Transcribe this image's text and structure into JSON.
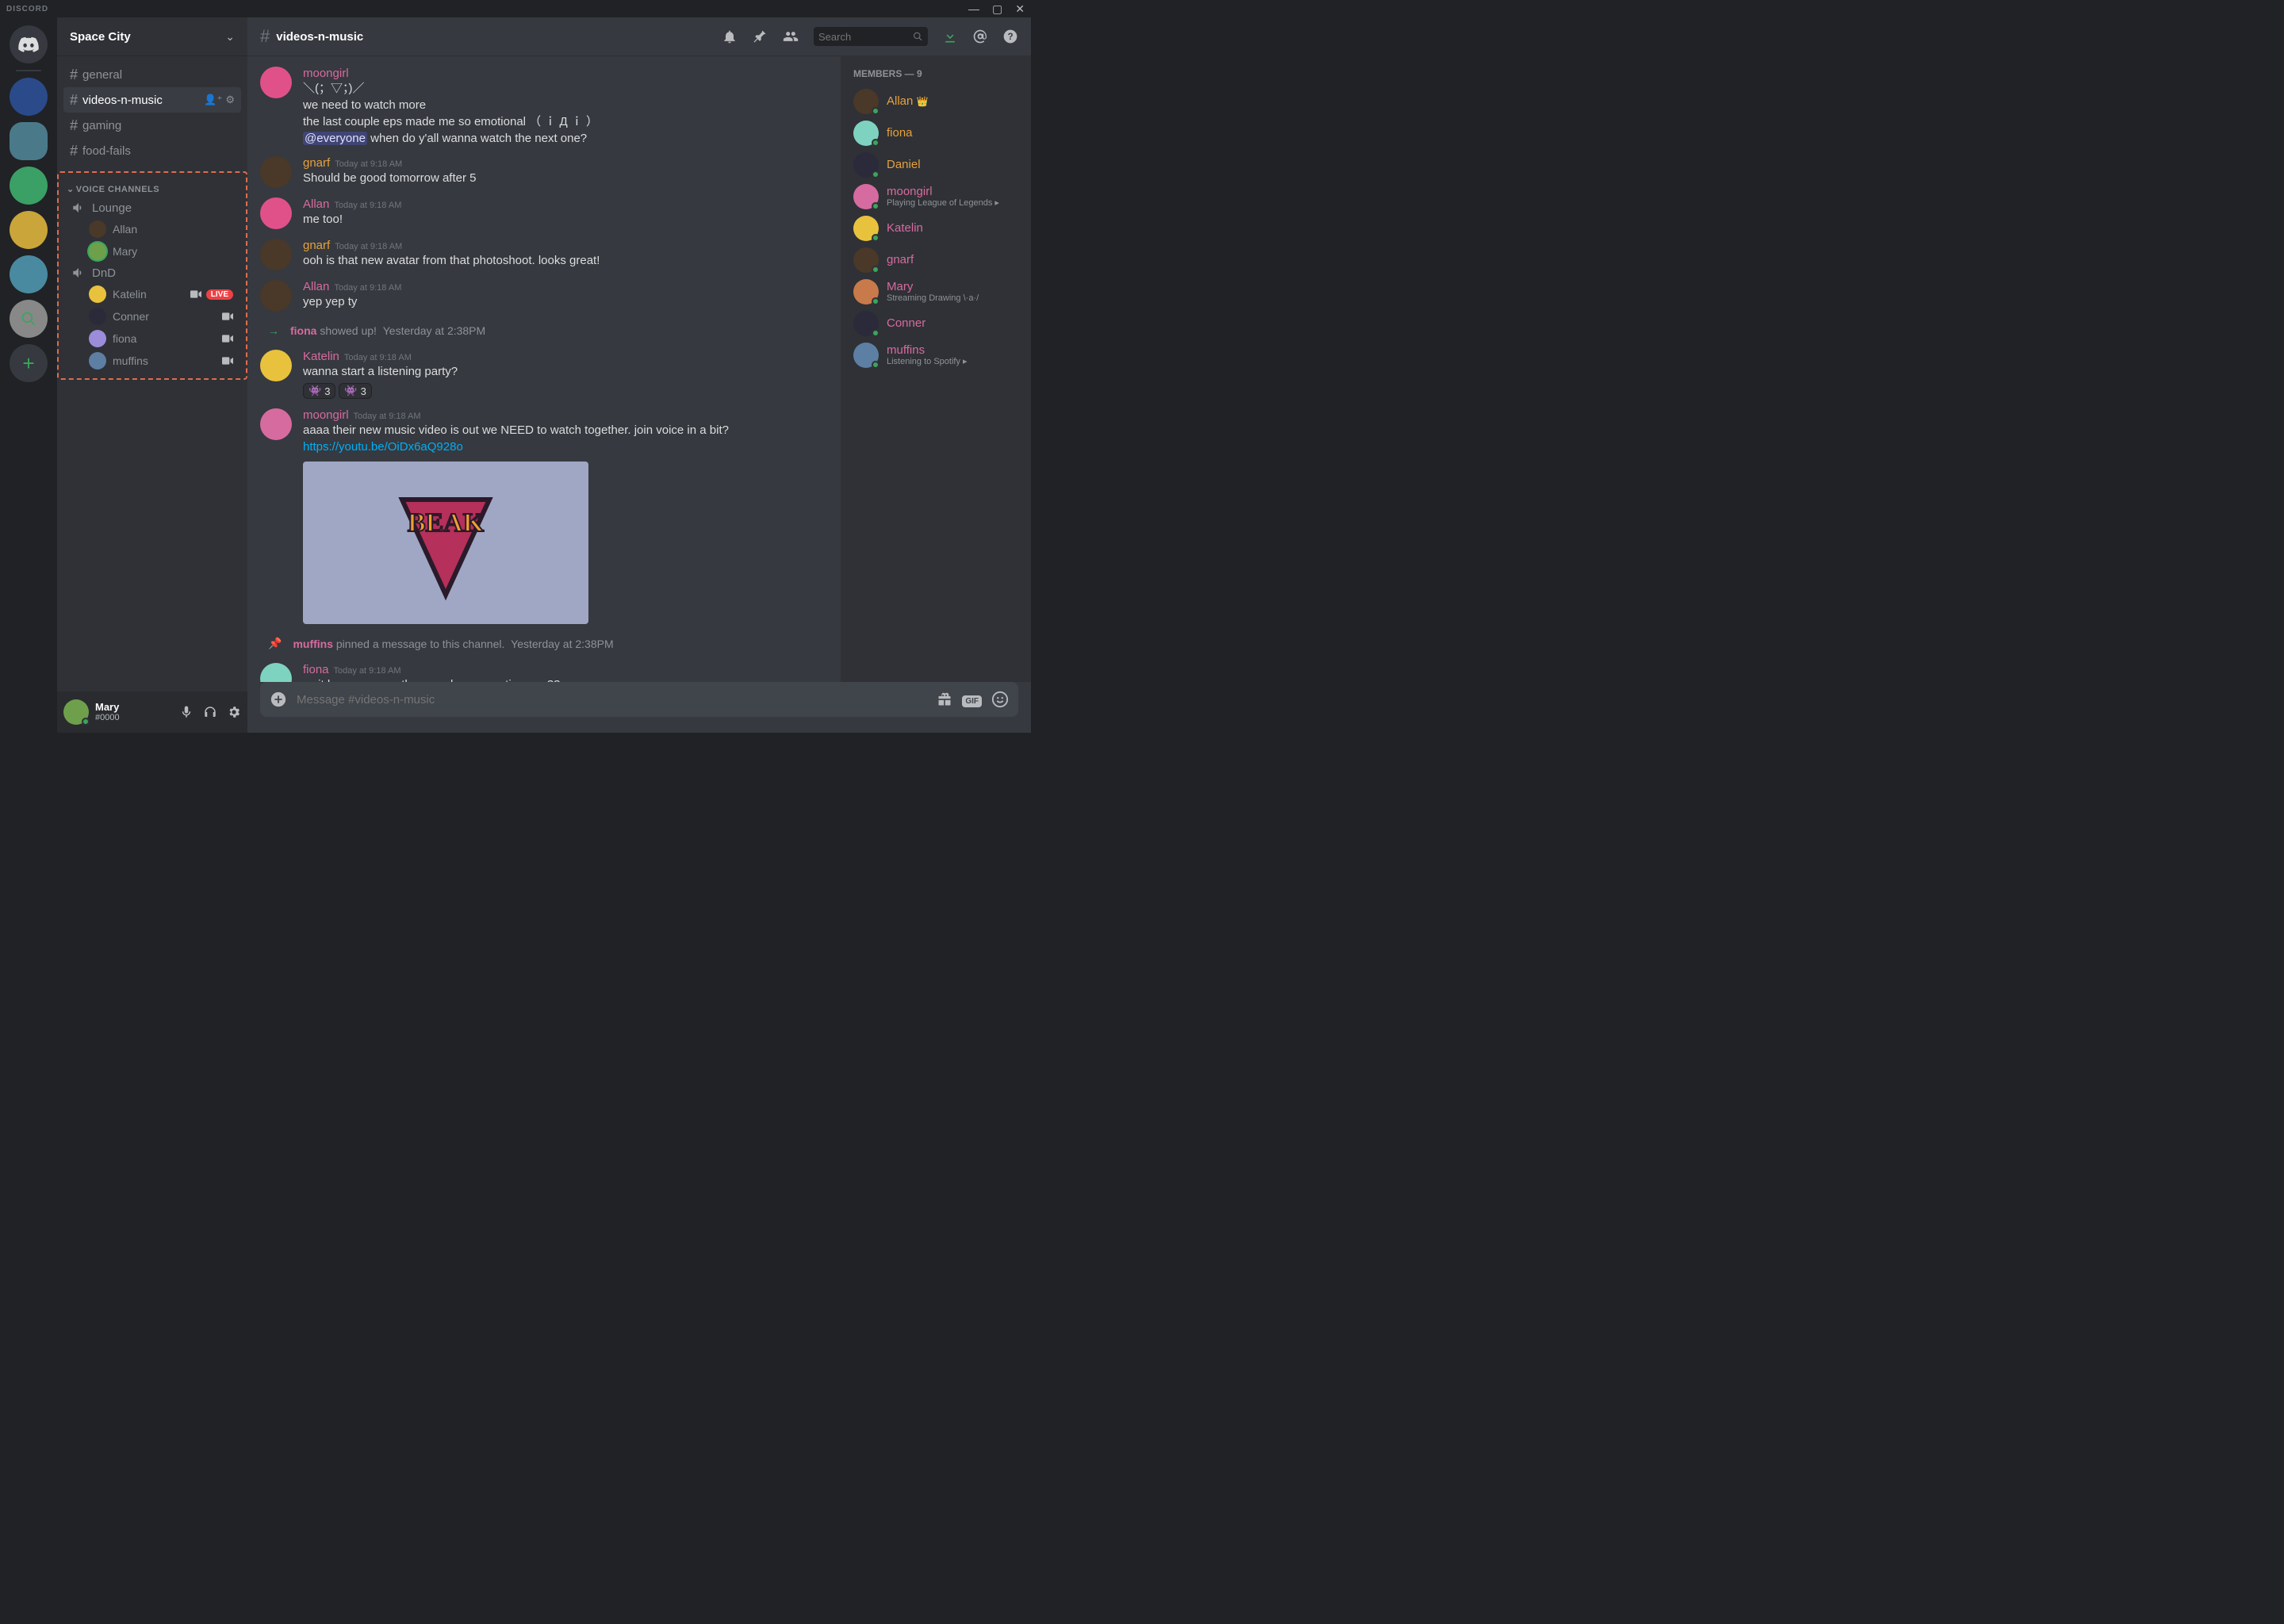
{
  "titlebar": {
    "brand": "DISCORD"
  },
  "server": {
    "name": "Space City"
  },
  "textChannels": [
    {
      "name": "general",
      "active": false
    },
    {
      "name": "videos-n-music",
      "active": true
    },
    {
      "name": "gaming",
      "active": false
    },
    {
      "name": "food-fails",
      "active": false
    }
  ],
  "voiceCategoryLabel": "VOICE CHANNELS",
  "voiceChannels": [
    {
      "name": "Lounge",
      "users": [
        {
          "name": "Allan",
          "live": false,
          "video": false,
          "av": "av-c3"
        },
        {
          "name": "Mary",
          "live": false,
          "video": false,
          "av": "av-c9",
          "speaking": true
        }
      ]
    },
    {
      "name": "DnD",
      "users": [
        {
          "name": "Katelin",
          "live": true,
          "video": true,
          "av": "av-c5"
        },
        {
          "name": "Conner",
          "live": false,
          "video": true,
          "av": "av-c7"
        },
        {
          "name": "fiona",
          "live": false,
          "video": true,
          "av": "av-c6"
        },
        {
          "name": "muffins",
          "live": false,
          "video": true,
          "av": "av-c8"
        }
      ]
    }
  ],
  "liveBadge": "LIVE",
  "selfUser": {
    "name": "Mary",
    "discriminator": "#0000"
  },
  "chatHeader": {
    "channel": "videos-n-music"
  },
  "searchPlaceholder": "Search",
  "composerPlaceholder": "Message #videos-n-music",
  "messages": [
    {
      "type": "msg",
      "author": "moongirl",
      "colorClass": "nm-pink",
      "ts": "",
      "av": "av-c11",
      "lines": [
        {
          "text": "＼(；▽；)／"
        },
        {
          "text": "we need to watch more"
        },
        {
          "text": "the last couple eps made me so emotional （ ｉ Д ｉ ）"
        },
        {
          "mention": "@everyone",
          "rest": " when do y'all wanna watch the next one?"
        }
      ]
    },
    {
      "type": "msg",
      "author": "gnarf",
      "colorClass": "nm-yellow",
      "ts": "Today at 9:18 AM",
      "av": "av-c3",
      "lines": [
        {
          "text": "Should be good tomorrow after 5"
        }
      ]
    },
    {
      "type": "msg",
      "author": "Allan",
      "colorClass": "nm-pink",
      "ts": "Today at 9:18 AM",
      "av": "av-c11",
      "lines": [
        {
          "text": "me too!"
        }
      ]
    },
    {
      "type": "msg",
      "author": "gnarf",
      "colorClass": "nm-yellow",
      "ts": "Today at 9:18 AM",
      "av": "av-c3",
      "lines": [
        {
          "text": "ooh is that new avatar from that photoshoot. looks great!"
        }
      ]
    },
    {
      "type": "msg",
      "author": "Allan",
      "colorClass": "nm-pink",
      "ts": "Today at 9:18 AM",
      "av": "av-c3",
      "lines": [
        {
          "text": "yep yep ty"
        }
      ]
    },
    {
      "type": "system-join",
      "actor": "fiona",
      "rest": " showed up!",
      "ts": "Yesterday at 2:38PM"
    },
    {
      "type": "msg",
      "author": "Katelin",
      "colorClass": "nm-pink",
      "ts": "Today at 9:18 AM",
      "av": "av-c5",
      "lines": [
        {
          "text": "wanna start a listening party?"
        }
      ],
      "reactions": [
        {
          "emoji": "👾",
          "count": "3"
        },
        {
          "emoji": "👾",
          "count": "3"
        }
      ]
    },
    {
      "type": "msg",
      "author": "moongirl",
      "colorClass": "nm-pink",
      "ts": "Today at 9:18 AM",
      "av": "av-c4",
      "lines": [
        {
          "text": "aaaa their new music video is out we NEED to watch together. join voice in a bit?"
        },
        {
          "link": "https://youtu.be/OiDx6aQ928o"
        }
      ],
      "embed": true
    },
    {
      "type": "system-pin",
      "actor": "muffins",
      "rest": " pinned a message to this channel.",
      "ts": "Yesterday at 2:38PM"
    },
    {
      "type": "msg",
      "author": "fiona",
      "colorClass": "nm-pink",
      "ts": "Today at 9:18 AM",
      "av": "av-c2",
      "lines": [
        {
          "text": "wait have you see the new dance practice one??"
        }
      ]
    }
  ],
  "members": {
    "header": "MEMBERS — 9",
    "list": [
      {
        "name": "Allan",
        "color": "#e6a13c",
        "av": "av-c3",
        "crown": true,
        "sub": ""
      },
      {
        "name": "fiona",
        "color": "#e6a13c",
        "av": "av-c2",
        "sub": ""
      },
      {
        "name": "Daniel",
        "color": "#e6a13c",
        "av": "av-c7",
        "sub": ""
      },
      {
        "name": "moongirl",
        "color": "#d66ba0",
        "av": "av-c4",
        "sub": "Playing League of Legends",
        "badge": true
      },
      {
        "name": "Katelin",
        "color": "#d66ba0",
        "av": "av-c5",
        "sub": ""
      },
      {
        "name": "gnarf",
        "color": "#d66ba0",
        "av": "av-c3",
        "sub": ""
      },
      {
        "name": "Mary",
        "color": "#d66ba0",
        "av": "av-c10",
        "sub": "Streaming Drawing \\·a·/"
      },
      {
        "name": "Conner",
        "color": "#d66ba0",
        "av": "av-c7",
        "sub": ""
      },
      {
        "name": "muffins",
        "color": "#d66ba0",
        "av": "av-c8",
        "sub": "Listening to Spotify",
        "badge": true
      }
    ]
  },
  "nameColors": {
    "nm-pink": "#d66ba0",
    "nm-yellow": "#e6a13c"
  }
}
